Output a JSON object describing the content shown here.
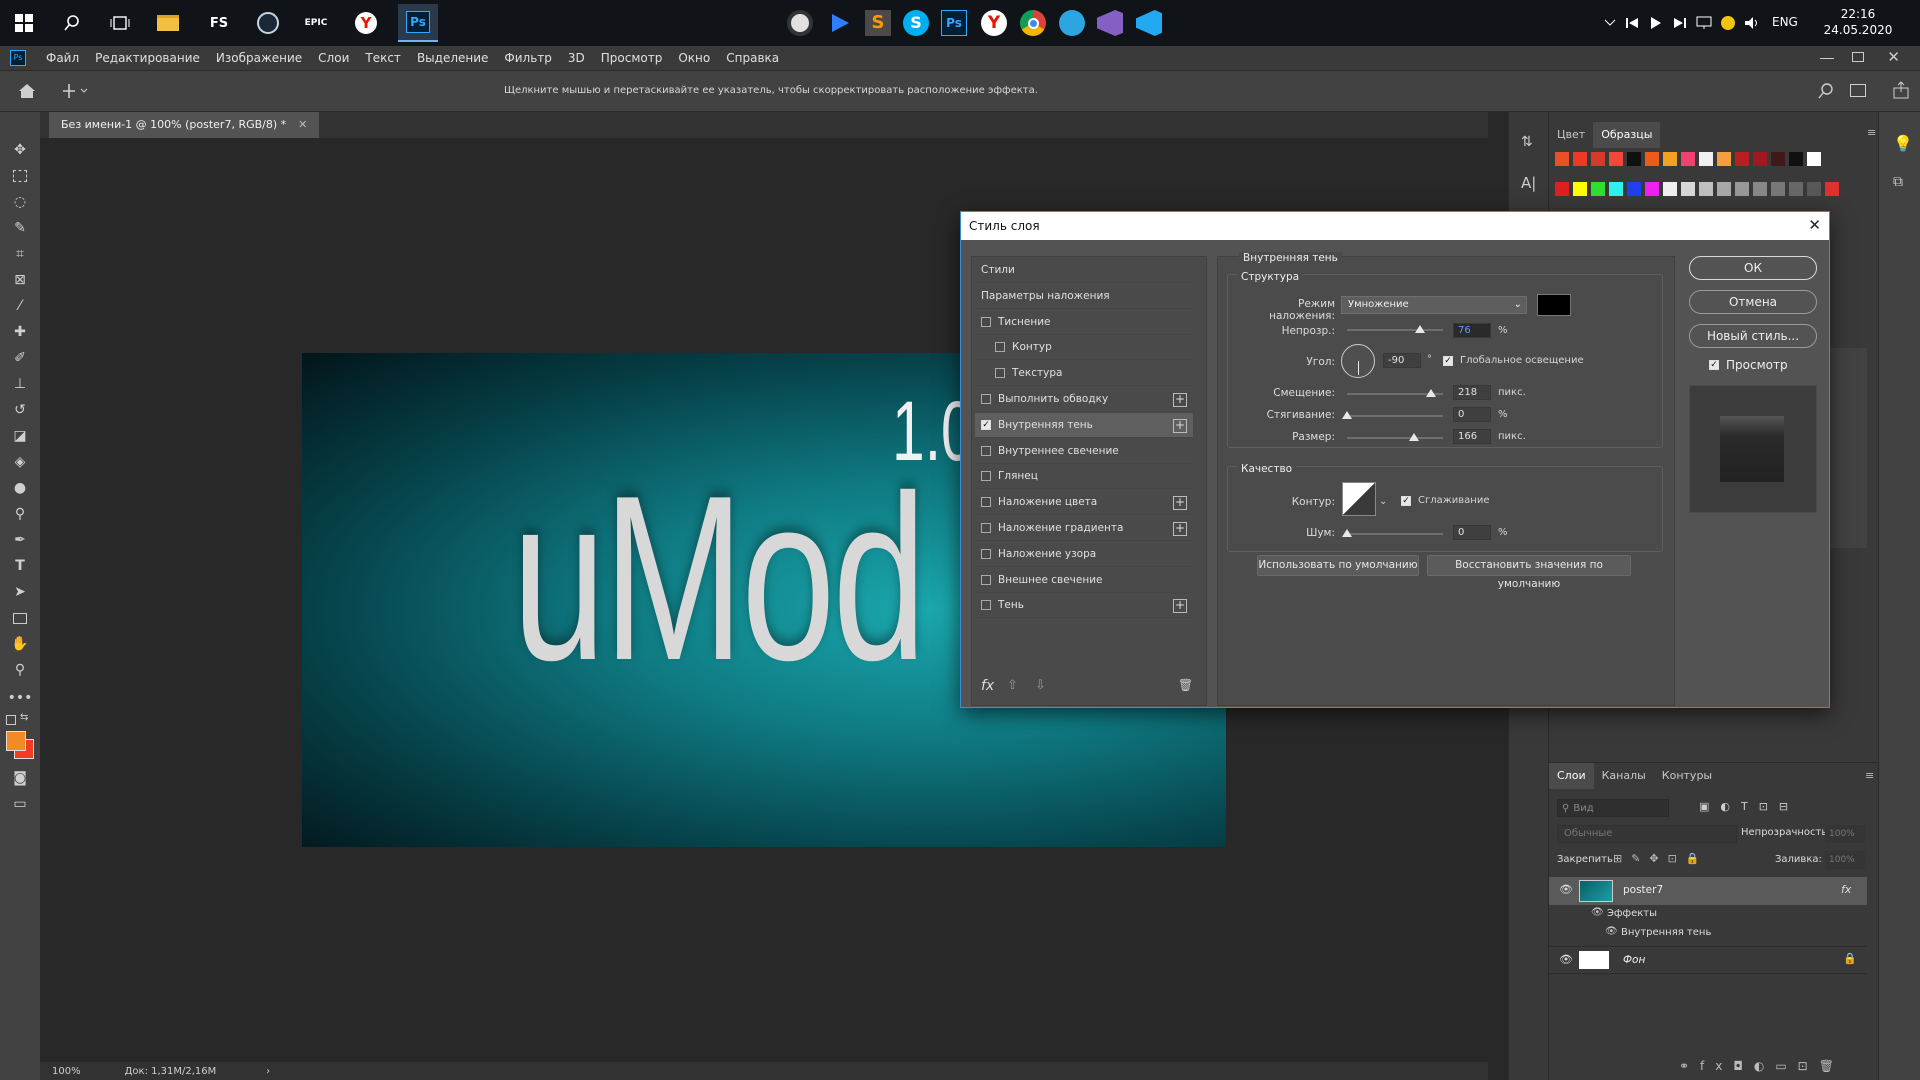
{
  "taskbar": {
    "left_apps": [
      "FS",
      "EPIC"
    ],
    "ps_label": "Ps",
    "pinned_ps_label": "Ps",
    "lang": "ENG",
    "time": "22:16",
    "date": "24.05.2020"
  },
  "menubar": {
    "logo": "Ps",
    "items": [
      "Файл",
      "Редактирование",
      "Изображение",
      "Слои",
      "Текст",
      "Выделение",
      "Фильтр",
      "3D",
      "Просмотр",
      "Окно",
      "Справка"
    ]
  },
  "options": {
    "hint": "Щелкните мышью и перетаскивайте ее указатель, чтобы скорректировать расположение эффекта."
  },
  "document": {
    "tab_title": "Без имени-1 @ 100% (poster7, RGB/8) *",
    "poster_version": "1.0",
    "poster_text": "uMod",
    "zoom": "100%",
    "doc_info": "Док: 1,31M/2,16M"
  },
  "right_panel": {
    "tabs": [
      "Цвет",
      "Образцы"
    ],
    "layers_tabs": [
      "Слои",
      "Каналы",
      "Контуры"
    ],
    "search_placeholder": "Вид",
    "blend_mode": "Обычные",
    "opacity_label": "Непрозрачность:",
    "opacity_value": "100%",
    "lock_label": "Закрепить:",
    "fill_label": "Заливка:",
    "fill_value": "100%",
    "layers": [
      {
        "name": "poster7"
      },
      {
        "name": "Эффекты"
      },
      {
        "name": "Внутренняя тень"
      },
      {
        "name": "Фон"
      }
    ],
    "swatch_colors": [
      "#e8502a",
      "#ec3a2a",
      "#d63a2a",
      "#f0483a",
      "#101010",
      "#ee5a1c",
      "#f4a020",
      "#f04070",
      "#f0f0f0",
      "#f4a040",
      "#b82020",
      "#a01820",
      "#401818",
      "#101010",
      "#ffffff",
      "#e02020",
      "#ffff00",
      "#30e030",
      "#30f0f0",
      "#2040f0",
      "#f020f0",
      "#f0f0f0",
      "#d8d8d8",
      "#c0c0c0",
      "#a8a8a8",
      "#989898",
      "#888888",
      "#787878",
      "#686868",
      "#585858",
      "#e03030"
    ]
  },
  "dialog": {
    "title": "Стиль слоя",
    "styles_list": [
      {
        "label": "Стили",
        "checkbox": false,
        "plus": false,
        "checked": false
      },
      {
        "label": "Параметры наложения",
        "checkbox": false,
        "plus": false,
        "checked": false
      },
      {
        "label": "Тиснение",
        "checkbox": true,
        "plus": false,
        "checked": false
      },
      {
        "label": "Контур",
        "checkbox": true,
        "plus": false,
        "checked": false,
        "indent": true
      },
      {
        "label": "Текстура",
        "checkbox": true,
        "plus": false,
        "checked": false,
        "indent": true
      },
      {
        "label": "Выполнить обводку",
        "checkbox": true,
        "plus": true,
        "checked": false
      },
      {
        "label": "Внутренняя тень",
        "checkbox": true,
        "plus": true,
        "checked": true
      },
      {
        "label": "Внутреннее свечение",
        "checkbox": true,
        "plus": false,
        "checked": false
      },
      {
        "label": "Глянец",
        "checkbox": true,
        "plus": false,
        "checked": false
      },
      {
        "label": "Наложение цвета",
        "checkbox": true,
        "plus": true,
        "checked": false
      },
      {
        "label": "Наложение градиента",
        "checkbox": true,
        "plus": true,
        "checked": false
      },
      {
        "label": "Наложение узора",
        "checkbox": true,
        "plus": false,
        "checked": false
      },
      {
        "label": "Внешнее свечение",
        "checkbox": true,
        "plus": false,
        "checked": false
      },
      {
        "label": "Тень",
        "checkbox": true,
        "plus": true,
        "checked": false
      }
    ],
    "fx_label": "fx",
    "section_title": "Внутренняя тень",
    "structure_title": "Структура",
    "blend_label": "Режим наложения:",
    "blend_value": "Умножение",
    "opacity_label": "Непрозр.:",
    "opacity_value": "76",
    "opacity_unit": "%",
    "angle_label": "Угол:",
    "angle_value": "-90",
    "angle_unit": "°",
    "global_light": "Глобальное освещение",
    "offset_label": "Смещение:",
    "offset_value": "218",
    "choke_label": "Стягивание:",
    "choke_value": "0",
    "size_label": "Размер:",
    "size_value": "166",
    "px_unit": "пикс.",
    "quality_title": "Качество",
    "contour_label": "Контур:",
    "antialias": "Сглаживание",
    "noise_label": "Шум:",
    "noise_value": "0",
    "btn_default": "Использовать по умолчанию",
    "btn_reset": "Восстановить значения по умолчанию",
    "btn_ok": "ОК",
    "btn_cancel": "Отмена",
    "btn_new_style": "Новый стиль...",
    "preview_label": "Просмотр",
    "slider_levels": {
      "opacity": 0.76,
      "offset": 0.87,
      "choke": 0.0,
      "size": 0.7,
      "noise": 0.0
    }
  }
}
